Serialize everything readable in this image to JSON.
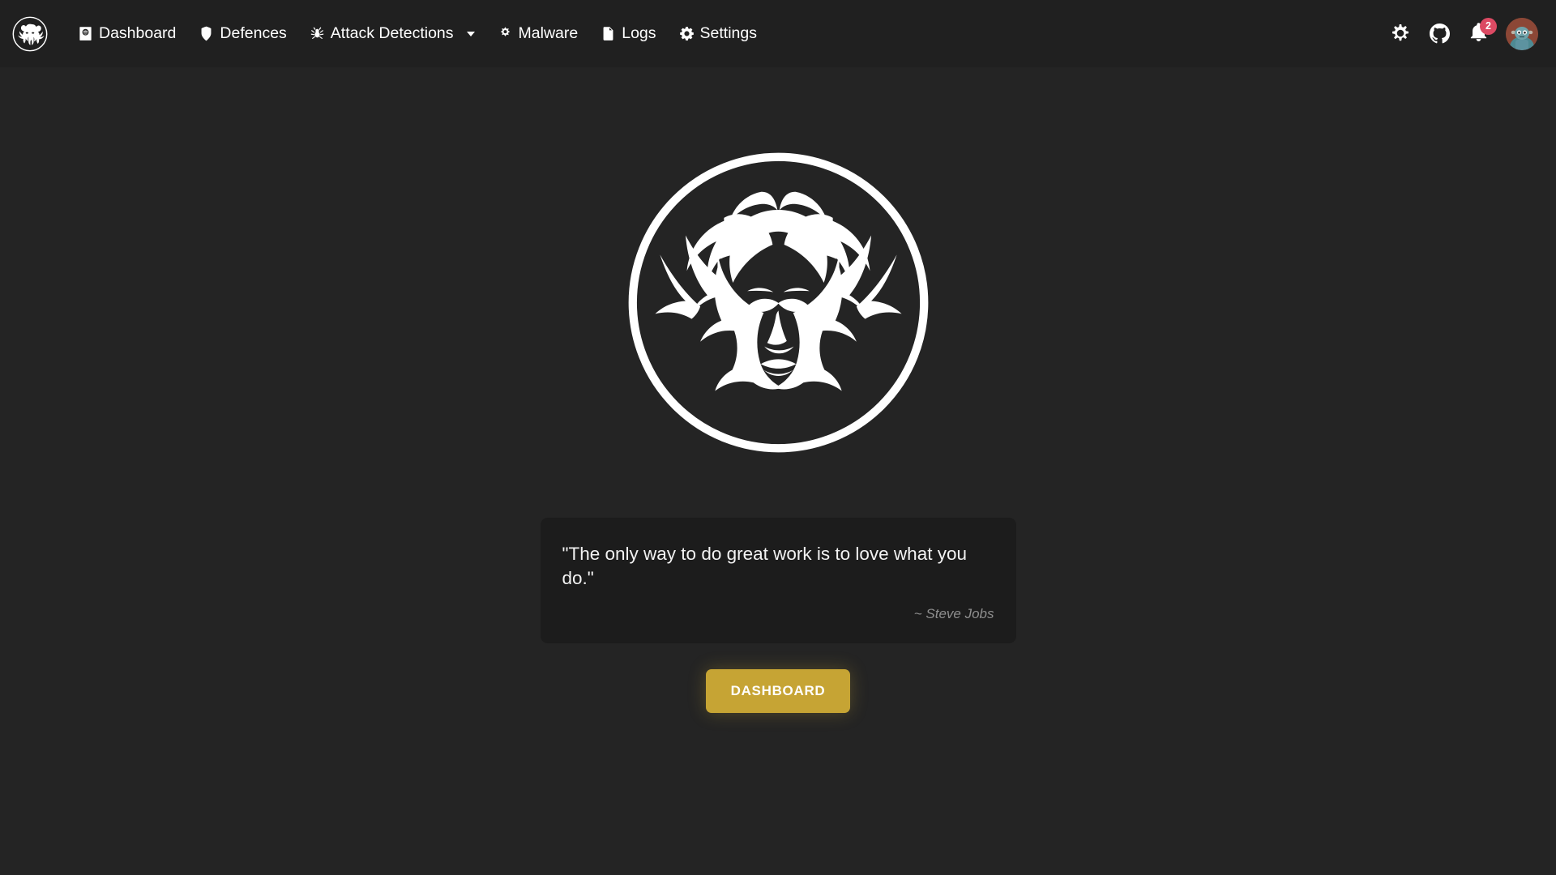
{
  "brand": {
    "logo_icon": "medusa-logo-icon",
    "name": "Medusa"
  },
  "navbar": {
    "items": [
      {
        "label": "Dashboard",
        "icon": "passport-globe-icon",
        "has_dropdown": false
      },
      {
        "label": "Defences",
        "icon": "shield-icon",
        "has_dropdown": false
      },
      {
        "label": "Attack Detections",
        "icon": "spider-icon",
        "has_dropdown": true
      },
      {
        "label": "Malware",
        "icon": "virus-icon",
        "has_dropdown": false
      },
      {
        "label": "Logs",
        "icon": "file-log-icon",
        "has_dropdown": false
      },
      {
        "label": "Settings",
        "icon": "gear-icon",
        "has_dropdown": false
      }
    ],
    "right_actions": [
      {
        "name": "theme-toggle",
        "icon": "sun-icon"
      },
      {
        "name": "github-link",
        "icon": "github-icon"
      },
      {
        "name": "notifications",
        "icon": "bell-icon",
        "badge": "2"
      },
      {
        "name": "user-avatar",
        "icon": "avatar-icon"
      }
    ]
  },
  "main": {
    "hero_logo_icon": "medusa-logo-icon",
    "quote": {
      "text": "\"The only way to do great work is to love what you do.\"",
      "author": "~ Steve Jobs"
    },
    "primary_button": "DASHBOARD"
  },
  "colors": {
    "navbar_bg": "#202020",
    "page_bg": "#242424",
    "card_bg": "#1c1c1c",
    "accent_gold": "#c6a434",
    "badge_red": "#dc4a63",
    "text_primary": "#ffffff",
    "text_muted": "#8e8e8e"
  }
}
